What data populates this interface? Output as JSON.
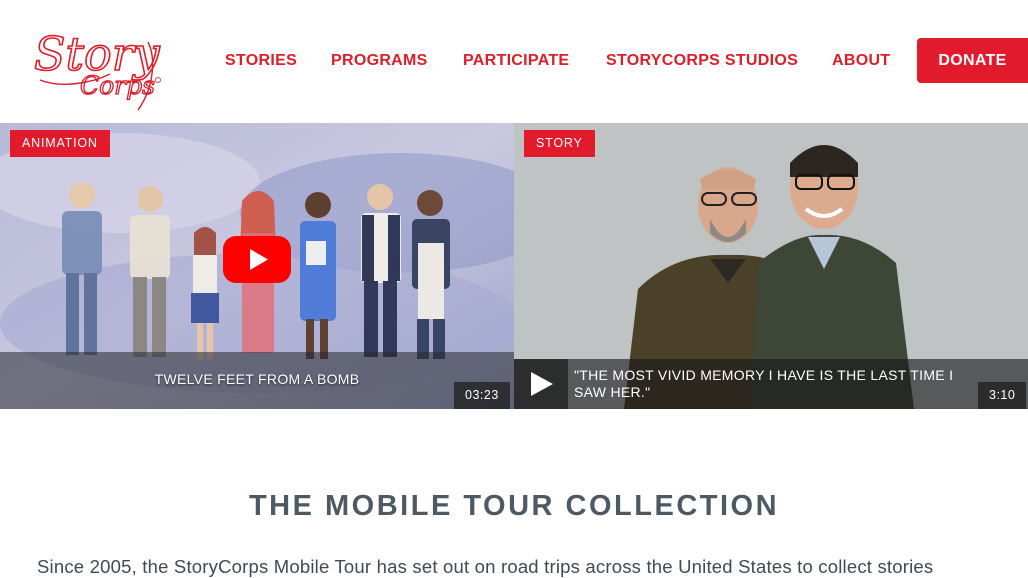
{
  "header": {
    "logo_text_1": "Story",
    "logo_text_2": "Corps",
    "nav": [
      {
        "label": "STORIES"
      },
      {
        "label": "PROGRAMS"
      },
      {
        "label": "PARTICIPATE"
      },
      {
        "label": "STORYCORPS STUDIOS"
      },
      {
        "label": "ABOUT"
      }
    ],
    "donate_label": "DONATE"
  },
  "hero": {
    "left": {
      "tag": "ANIMATION",
      "title": "TWELVE FEET FROM A BOMB",
      "duration": "03:23"
    },
    "right": {
      "tag": "STORY",
      "title": "\"THE MOST VIVID MEMORY I HAVE IS THE LAST TIME I SAW HER.\"",
      "duration": "3:10"
    }
  },
  "section": {
    "title": "THE MOBILE TOUR COLLECTION",
    "intro": "Since 2005, the StoryCorps Mobile Tour has set out on road trips across the United States to collect stories"
  },
  "colors": {
    "brand_red": "#e11b2b",
    "nav_red": "#d81f2a",
    "heading_gray": "#4d5963"
  }
}
